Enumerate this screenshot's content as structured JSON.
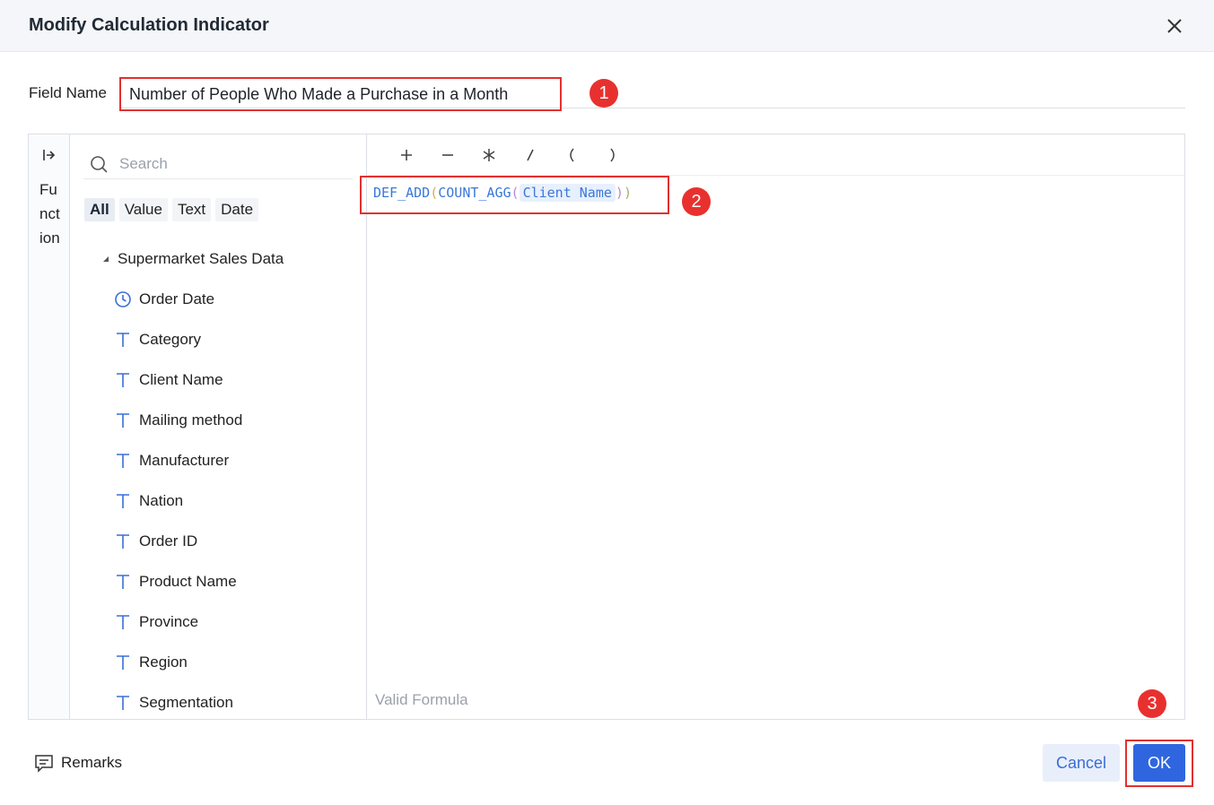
{
  "dialog": {
    "title": "Modify Calculation Indicator"
  },
  "field_name": {
    "label": "Field Name",
    "value": "Number of People Who Made a Purchase in a Month"
  },
  "function_panel": {
    "label": "Function"
  },
  "search": {
    "placeholder": "Search"
  },
  "filter_tabs": [
    "All",
    "Value",
    "Text",
    "Date"
  ],
  "tree": {
    "root": "Supermarket Sales Data",
    "items": [
      {
        "label": "Order Date",
        "icon": "clock-icon"
      },
      {
        "label": "Category",
        "icon": "text-field-icon"
      },
      {
        "label": "Client Name",
        "icon": "text-field-icon"
      },
      {
        "label": "Mailing method",
        "icon": "text-field-icon"
      },
      {
        "label": "Manufacturer",
        "icon": "text-field-icon"
      },
      {
        "label": "Nation",
        "icon": "text-field-icon"
      },
      {
        "label": "Order ID",
        "icon": "text-field-icon"
      },
      {
        "label": "Product Name",
        "icon": "text-field-icon"
      },
      {
        "label": "Province",
        "icon": "text-field-icon"
      },
      {
        "label": "Region",
        "icon": "text-field-icon"
      },
      {
        "label": "Segmentation",
        "icon": "text-field-icon"
      }
    ]
  },
  "operators": [
    "+",
    "−",
    "*",
    "/",
    "(",
    ")"
  ],
  "formula": {
    "func_outer": "DEF_ADD",
    "func_inner": "COUNT_AGG",
    "field": "Client Name"
  },
  "status": {
    "validity": "Valid Formula"
  },
  "footer": {
    "remarks_label": "Remarks",
    "cancel_label": "Cancel",
    "ok_label": "OK"
  },
  "annotations": [
    "1",
    "2",
    "3"
  ],
  "colors": {
    "primary": "#2f66df",
    "annotation_red": "#e3302f",
    "formula_blue": "#3a78d8"
  }
}
